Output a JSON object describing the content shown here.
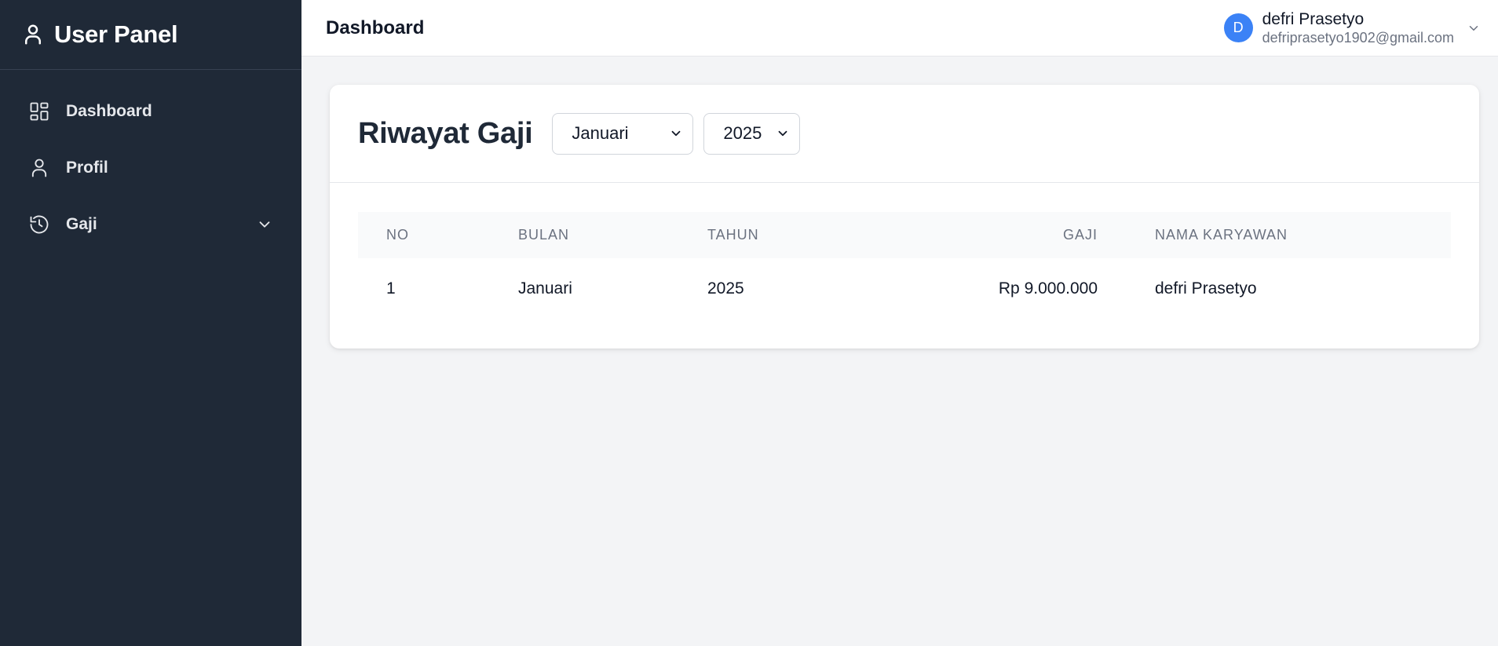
{
  "sidebar": {
    "brand": "User Panel",
    "items": [
      {
        "label": "Dashboard",
        "icon": "dashboard-grid-icon"
      },
      {
        "label": "Profil",
        "icon": "user-icon"
      },
      {
        "label": "Gaji",
        "icon": "history-icon",
        "has_submenu": true
      }
    ]
  },
  "topbar": {
    "title": "Dashboard",
    "user": {
      "initial": "D",
      "name": "defri Prasetyo",
      "email": "defriprasetyo1902@gmail.com"
    }
  },
  "main": {
    "title": "Riwayat Gaji",
    "filters": {
      "month": "Januari",
      "year": "2025"
    },
    "table": {
      "headers": [
        "NO",
        "BULAN",
        "TAHUN",
        "GAJI",
        "NAMA KARYAWAN"
      ],
      "rows": [
        [
          "1",
          "Januari",
          "2025",
          "Rp 9.000.000",
          "defri Prasetyo"
        ]
      ]
    }
  },
  "colors": {
    "sidebar_bg": "#1f2937",
    "avatar_bg": "#3b82f6",
    "page_bg": "#f3f4f6"
  }
}
